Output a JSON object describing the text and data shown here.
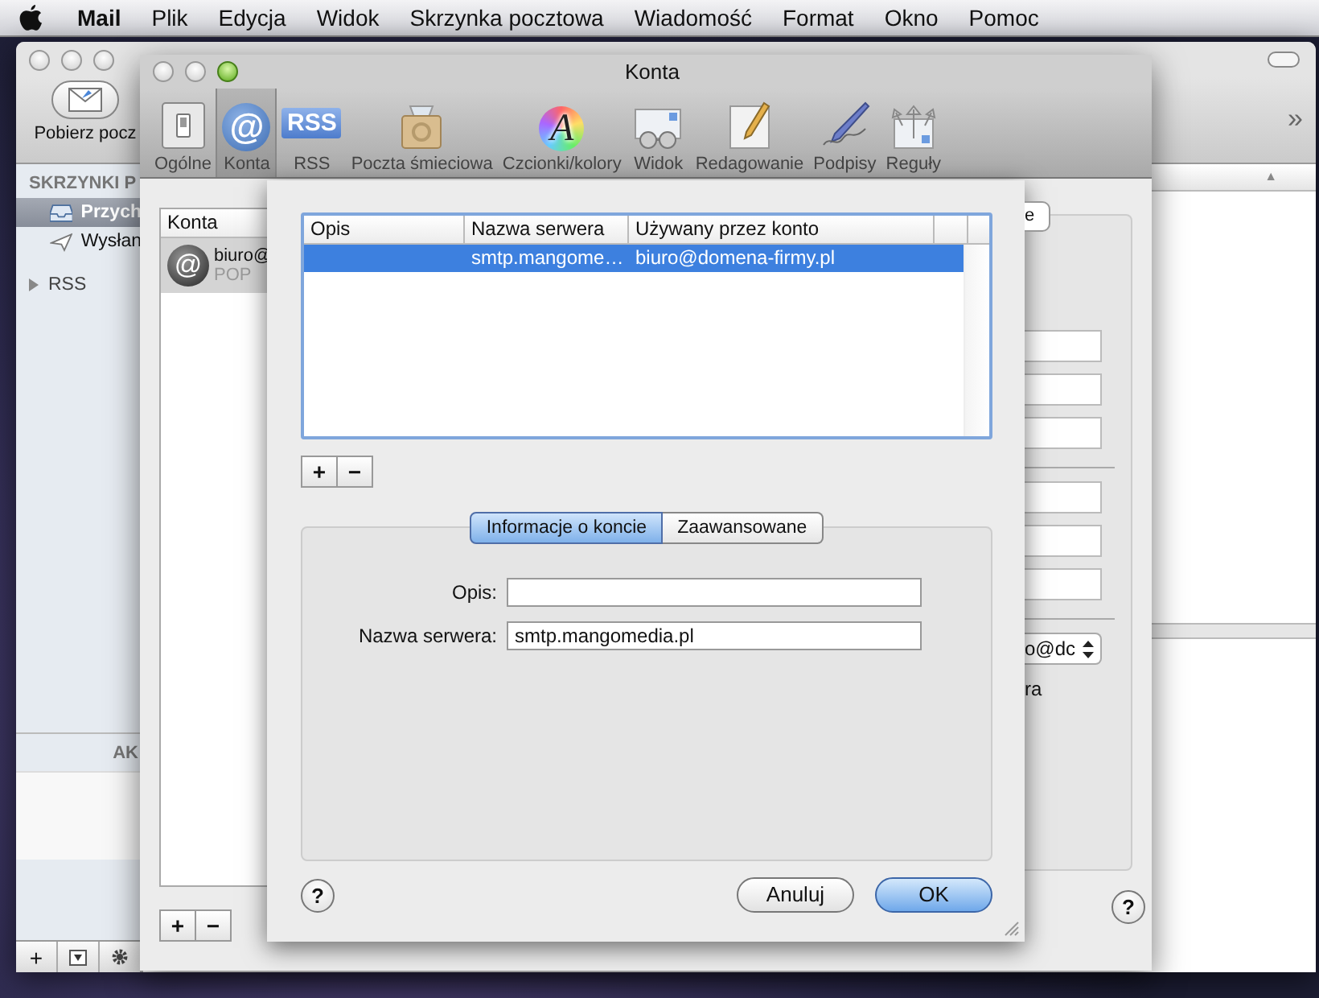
{
  "menu_bar": {
    "app": "Mail",
    "items": [
      "Plik",
      "Edycja",
      "Widok",
      "Skrzynka pocztowa",
      "Wiadomość",
      "Format",
      "Okno",
      "Pomoc"
    ]
  },
  "mail_window": {
    "toolbar_button": "Pobierz pocz",
    "overflow": "»",
    "sidebar_header": "SKRZYNKI P",
    "mailboxes": [
      {
        "label": "Przych",
        "selected": true
      },
      {
        "label": "Wysłan",
        "selected": false
      }
    ],
    "groups": [
      {
        "label": "RSS",
        "expanded": false
      }
    ],
    "activity_header": "AK",
    "sort_arrow": "▲",
    "bottom_buttons": [
      "+"
    ]
  },
  "preferences_window": {
    "title": "Konta",
    "toolbar": [
      {
        "label": "Ogólne",
        "selected": false
      },
      {
        "label": "Konta",
        "selected": true,
        "glyph": "@"
      },
      {
        "label": "RSS",
        "selected": false,
        "glyph": "RSS"
      },
      {
        "label": "Poczta śmieciowa",
        "selected": false
      },
      {
        "label": "Czcionki/kolory",
        "selected": false,
        "glyph": "A"
      },
      {
        "label": "Widok",
        "selected": false
      },
      {
        "label": "Redagowanie",
        "selected": false
      },
      {
        "label": "Podpisy",
        "selected": false
      },
      {
        "label": "Reguły",
        "selected": false
      }
    ],
    "accounts_header": "Konta",
    "accounts": [
      {
        "name": "biuro@",
        "type": "POP",
        "glyph": "@",
        "selected": true
      }
    ],
    "list_buttons": [
      "+",
      "−"
    ],
    "hidden_button_fragment": "e",
    "popup_fragment": "o@dc",
    "checkbox_fragment": "ra",
    "help": "?"
  },
  "smtp_sheet": {
    "columns": [
      "Opis",
      "Nazwa serwera",
      "Używany przez konto"
    ],
    "rows": [
      {
        "server": "smtp.mangome…",
        "account": "biuro@domena-firmy.pl",
        "selected": true
      }
    ],
    "list_buttons": [
      "+",
      "−"
    ],
    "tabs": [
      {
        "label": "Informacje o koncie",
        "selected": true
      },
      {
        "label": "Zaawansowane",
        "selected": false
      }
    ],
    "fields": [
      {
        "label": "Opis:"
      },
      {
        "label": "Nazwa serwera:",
        "value": "smtp.mangomedia.pl"
      }
    ],
    "help": "?",
    "cancel": "Anuluj",
    "ok": "OK"
  }
}
